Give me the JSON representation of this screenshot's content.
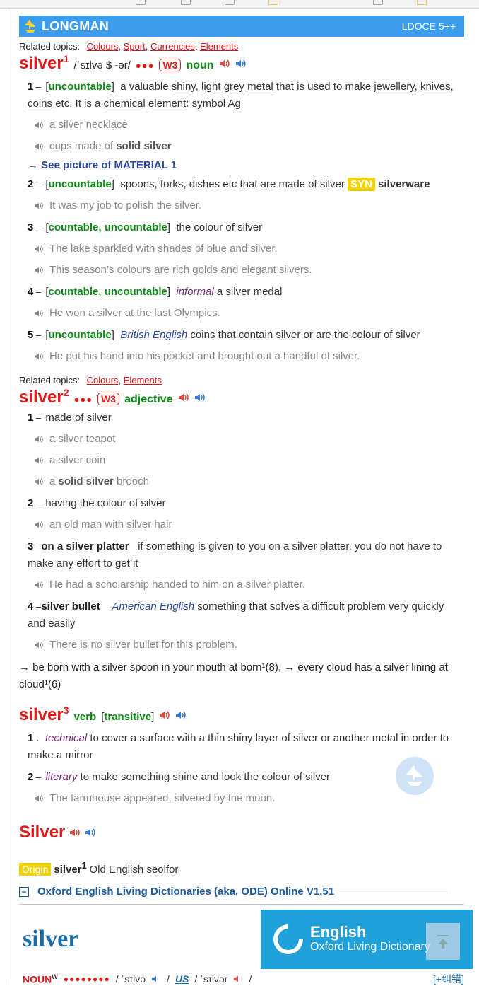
{
  "brand": {
    "name": "LONGMAN",
    "version": "LDOCE 5++"
  },
  "related_label": "Related topics:",
  "entry1": {
    "topics": [
      "Colours",
      "Sport",
      "Currencies",
      "Elements"
    ],
    "headword": "silver",
    "hom": "1",
    "pron": "/ˈsɪlvə $ -ər/",
    "dots": "●●●",
    "w3": "W3",
    "pos": "noun",
    "s1": {
      "num": "1",
      "gram": "uncountable",
      "p1": "a valuable ",
      "l1": "shiny",
      "p2": ", ",
      "l2": "light",
      "p3": " ",
      "l3": "grey",
      "p4": " ",
      "l4": "metal",
      "p5": " that is used to make ",
      "l5": "jewellery",
      "p6": ",",
      "l6": "knives",
      "p7": ", ",
      "l7": "coins",
      "p8": " etc. It is a ",
      "l8": "chemical",
      "p9": " ",
      "l9": "element",
      "p10": ": symbol Ag",
      "ex1": "a silver necklace",
      "ex2_a": "cups made of ",
      "ex2_b": "solid silver",
      "xref": "→  See picture of MATERIAL 1"
    },
    "s2": {
      "num": "2",
      "gram": "uncountable",
      "p1": "spoons, forks, dishes etc that are made of silver",
      "syn": "SYN",
      "synword": "silverware",
      "ex1": "It was my job to polish the silver."
    },
    "s3": {
      "num": "3",
      "gram": "countable, uncountable",
      "p1": "the colour of silver",
      "ex1": "The lake sparkled with shades of blue and silver.",
      "ex2": "This season’s colours are rich golds and elegant silvers."
    },
    "s4": {
      "num": "4",
      "gram": "countable, uncountable",
      "reg": "informal",
      "p1": "a silver medal",
      "ex1": "He won a silver at the last Olympics."
    },
    "s5": {
      "num": "5",
      "gram": "uncountable",
      "geo": "British English",
      "p1": "coins that contain silver or are the colour of silver",
      "ex1": "He put his hand into his pocket and brought out a handful of silver."
    }
  },
  "entry2": {
    "topics": [
      "Colours",
      "Elements"
    ],
    "headword": "silver",
    "hom": "2",
    "dots": "●●●",
    "w3": "W3",
    "pos": "adjective",
    "s1": {
      "num": "1",
      "p1": "made of silver",
      "ex1": "a silver teapot",
      "ex2": "a silver coin",
      "ex3_a": "a ",
      "ex3_b": "solid silver",
      "ex3_c": " brooch"
    },
    "s2": {
      "num": "2",
      "p1": "having the colour of silver",
      "ex1": "an old man with silver hair"
    },
    "s3": {
      "num": "3",
      "phrase": "on a silver platter",
      "p1": "if something is given to you on a silver platter, you do not have to make any effort to get it",
      "ex1": "He had a scholarship handed to him on a silver platter."
    },
    "s4": {
      "num": "4",
      "phrase": "silver bullet",
      "geo": "American English",
      "p1": "something that solves a difficult problem very quickly and easily",
      "ex1": "There is no silver bullet for this problem."
    },
    "runon": "→ be born with a silver spoon in your mouth at born¹(8), → every cloud has a silver lining at cloud¹(6)"
  },
  "entry3": {
    "headword": "silver",
    "hom": "3",
    "pos": "verb",
    "gram": "transitive",
    "s1": {
      "num": "1",
      "reg": "technical",
      "p1": "to cover a surface with a thin shiny layer of silver or another metal in order to make a mirror"
    },
    "s2": {
      "num": "2",
      "reg": "literary",
      "p1": "to make something shine and look the colour of silver",
      "ex1": "The farmhouse appeared, silvered by the moon."
    }
  },
  "simple": {
    "headword": "Silver"
  },
  "origin": {
    "tag": "Origin",
    "word": "silver",
    "hom": "1",
    "text": "Old English seolfor"
  },
  "oed": {
    "title": "Oxford English Living Dictionaries (aka. ODE) Online V1.51",
    "collapse": "−",
    "word": "silver",
    "brand1": "English",
    "brand2": "Oxford Living Dictionary",
    "noun": "NOUN",
    "noun_sup": "W",
    "freq": "●●●●●●●●",
    "pron_uk": "/ ˈsɪlvə",
    "us": "US",
    "pron_us": "/ ˈsɪlvər",
    "fix": "[+纠错]"
  }
}
